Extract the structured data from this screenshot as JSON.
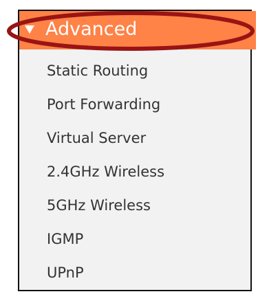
{
  "advanced_menu": {
    "header": {
      "label": "Advanced",
      "expanded_icon": "triangle-down-icon",
      "background_color": "#ff8247",
      "highlight_color": "#9a1414"
    },
    "items": [
      {
        "label": "Static Routing"
      },
      {
        "label": "Port Forwarding"
      },
      {
        "label": "Virtual Server"
      },
      {
        "label": "2.4GHz Wireless"
      },
      {
        "label": "5GHz Wireless"
      },
      {
        "label": "IGMP"
      },
      {
        "label": "UPnP"
      }
    ]
  }
}
